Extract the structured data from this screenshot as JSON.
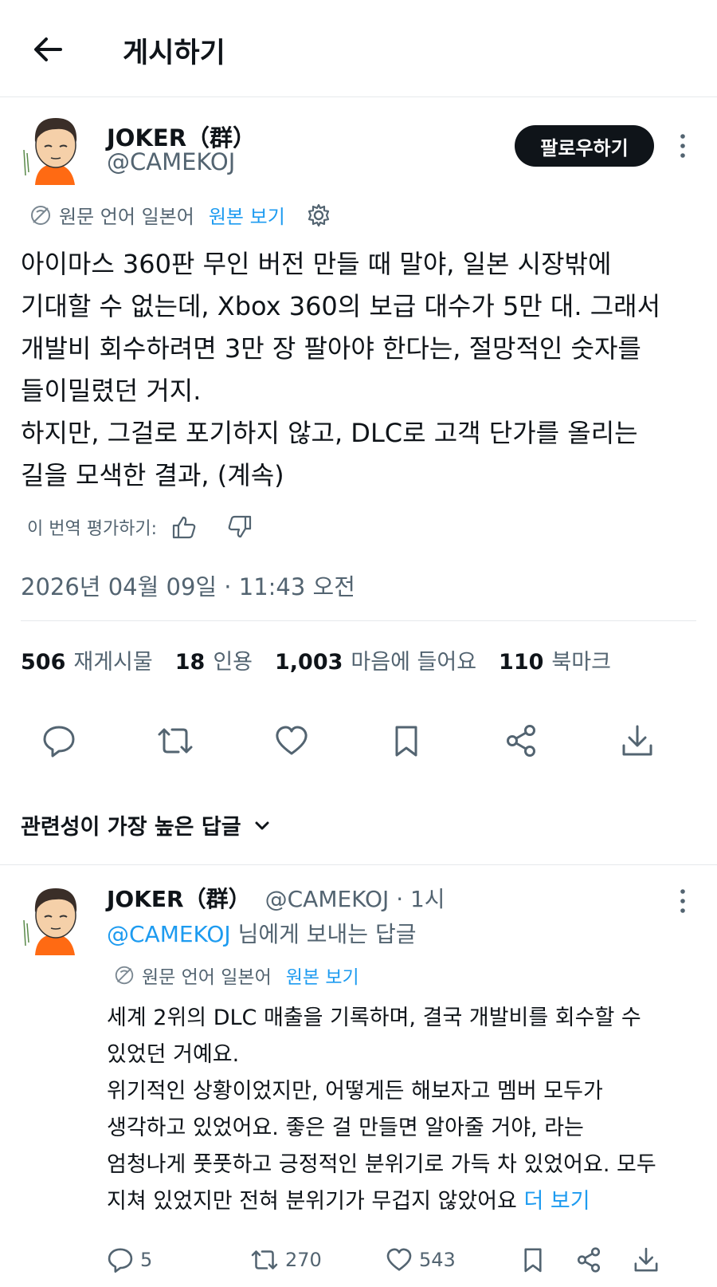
{
  "header": {
    "title": "게시하기"
  },
  "post": {
    "author_name": "JOKER（群）",
    "author_handle": "@CAMEKOJ",
    "follow_label": "팔로우하기",
    "translation": {
      "source_text": "원문 언어 일본어",
      "view_original": "원본 보기"
    },
    "body": "아이마스 360판 무인 버전 만들 때 말야, 일본 시장밖에\n기대할 수 없는데, Xbox 360의 보급 대수가 5만 대. 그래서\n개발비 회수하려면 3만 장 팔아야 한다는, 절망적인 숫자를\n들이밀렸던 거지.\n하지만, 그걸로 포기하지 않고, DLC로 고객 단가를 올리는\n길을 모색한 결과, (계속)",
    "rate_translation": "이 번역 평가하기:",
    "timestamp": "2026년 04월 09일 · 11:43 오전",
    "stats": {
      "reposts": {
        "count": "506",
        "label": "재게시물"
      },
      "quotes": {
        "count": "18",
        "label": "인용"
      },
      "likes": {
        "count": "1,003",
        "label": "마음에 들어요"
      },
      "bookmarks": {
        "count": "110",
        "label": "북마크"
      }
    }
  },
  "sort": {
    "label": "관련성이 가장 높은 답글"
  },
  "reply": {
    "author_name": "JOKER（群）",
    "meta": "@CAMEKOJ · 1시",
    "replying_mention": "@CAMEKOJ",
    "replying_suffix": " 님에게 보내는 답글",
    "translation": {
      "source_text": "원문 언어 일본어",
      "view_original": "원본 보기"
    },
    "body": "세계 2위의 DLC 매출을 기록하며, 결국 개발비를 회수할 수\n있었던 거예요.\n위기적인 상황이었지만, 어떻게든 해보자고 멤버 모두가\n생각하고 있었어요. 좋은 걸 만들면 알아줄 거야, 라는\n엄청나게 풋풋하고 긍정적인 분위기로 가득 차 있었어요. 모두\n지쳐 있었지만 전혀 분위기가 무겁지 않았어요 ",
    "more_label": "더 보기",
    "counts": {
      "replies": "5",
      "reposts": "270",
      "likes": "543"
    }
  },
  "colors": {
    "accent": "#1d9bf0",
    "text": "#0f1419",
    "muted": "#536471",
    "border": "#e6e9eb",
    "avatar_shirt": "#ff6a13"
  },
  "icons": [
    "back-arrow-icon",
    "more-icon",
    "translate-icon",
    "gear-icon",
    "thumbs-up-icon",
    "thumbs-down-icon",
    "reply-icon",
    "repost-icon",
    "like-icon",
    "bookmark-icon",
    "share-icon",
    "download-icon",
    "chevron-down-icon"
  ]
}
